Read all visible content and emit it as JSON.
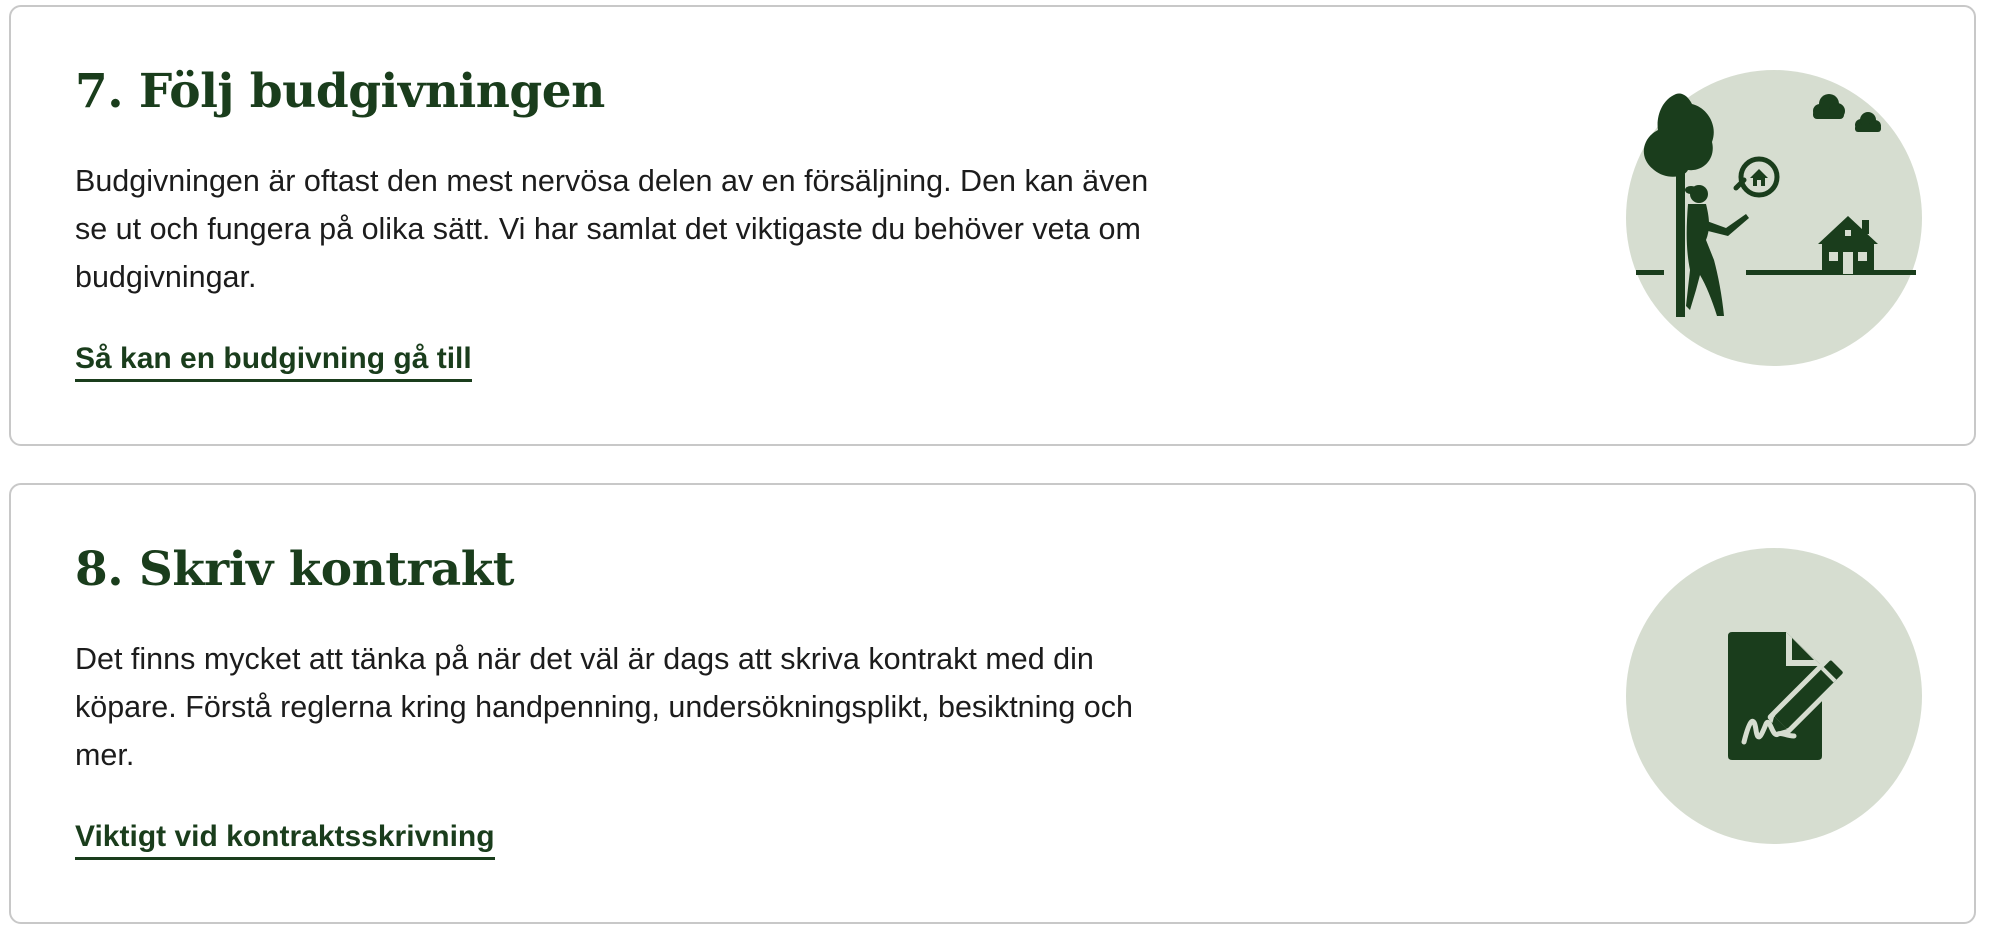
{
  "colors": {
    "accent_dark_green": "#1a3d1c",
    "illustration_circle_bg": "#d6ddd0",
    "card_border": "#c8c8c8",
    "body_text": "#1c1c1c"
  },
  "steps": [
    {
      "title": "7. Följ budgivningen",
      "description": "Budgivningen är oftast den mest nervösa delen av en försäljning. Den kan även se ut och fungera på olika sätt. Vi har samlat det viktigaste du behöver veta om budgivningar.",
      "link_label": "Så kan en budgivning gå till",
      "illustration": "person-by-tree-searching-house-icon"
    },
    {
      "title": "8. Skriv kontrakt",
      "description": "Det finns mycket att tänka på när det väl är dags att skriva kontrakt med din köpare. Förstå reglerna kring handpenning, undersökningsplikt, besiktning och mer.",
      "link_label": "Viktigt vid kontraktsskrivning",
      "illustration": "signed-document-pen-icon"
    }
  ]
}
